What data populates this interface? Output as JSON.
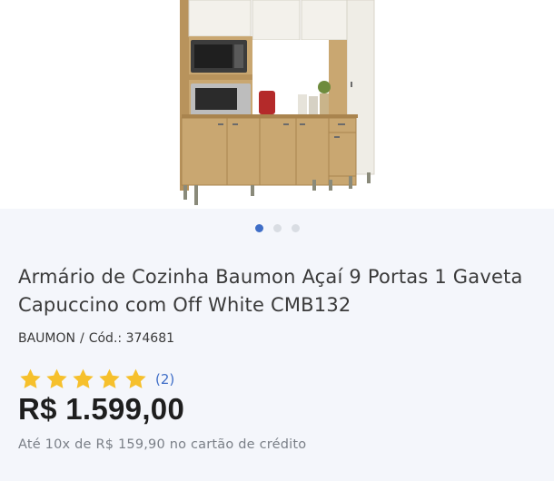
{
  "product": {
    "title": "Armário de Cozinha Baumon Açaí 9 Portas 1 Gaveta Capuccino com Off White CMB132",
    "brand": "BAUMON",
    "code_separator": "/",
    "code_label": "Cód.: 374681",
    "rating": {
      "stars": 5,
      "max": 5,
      "count_label": "(2)"
    },
    "price": "R$ 1.599,00",
    "installments": "Até 10x de R$ 159,90 no cartão de crédito"
  },
  "carousel": {
    "total": 3,
    "active_index": 0
  },
  "colors": {
    "accent": "#3f6ec7",
    "star": "#f6c02c",
    "wood": "#c7a46c",
    "off_white": "#f2f0ea"
  }
}
